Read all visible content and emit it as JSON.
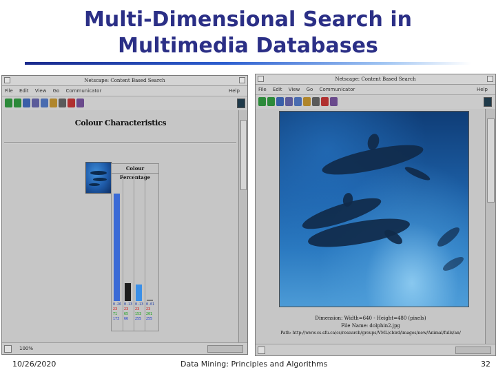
{
  "slide": {
    "title_line1": "Multi-Dimensional Search in",
    "title_line2": "Multimedia Databases",
    "footer_date": "10/26/2020",
    "footer_center": "Data Mining: Principles and Algorithms",
    "footer_page": "32",
    "colors": {
      "title": "#2b2f86",
      "rule_start": "#1a2a8c",
      "rule_end": "#9fc4f2"
    }
  },
  "left_window": {
    "title": "Netscape: Content Based Search",
    "menu": [
      "File",
      "Edit",
      "View",
      "Go",
      "Communicator"
    ],
    "help": "Help",
    "page_heading": "Colour Characteristics",
    "chart_title": "Colour Percentage",
    "bars": [
      {
        "value": 0.85,
        "color": "#3a6ad6"
      },
      {
        "value": 0.14,
        "color": "#1d1d1d"
      },
      {
        "value": 0.13,
        "color": "#3a8fe8"
      },
      {
        "value": 0.01,
        "color": "#7a7a7a"
      }
    ],
    "columns": [
      {
        "pct": "0.26",
        "r": "23",
        "g": "71",
        "b": "173"
      },
      {
        "pct": "0.13",
        "r": "23",
        "g": "65",
        "b": "66"
      },
      {
        "pct": "0.13",
        "r": "23",
        "g": "153",
        "b": "255"
      },
      {
        "pct": "0.01",
        "r": "23",
        "g": "201",
        "b": "255"
      }
    ],
    "status_text": "100%",
    "toolbar_icons": [
      "back-icon",
      "forward-icon",
      "reload-icon",
      "home-icon",
      "search-icon",
      "guide-icon",
      "print-icon",
      "security-icon",
      "stop-icon"
    ]
  },
  "right_window": {
    "title": "Netscape: Content Based Search",
    "menu": [
      "File",
      "Edit",
      "View",
      "Go",
      "Communicator"
    ],
    "help": "Help",
    "caption_dimension": "Dimension: Width=640 - Height=480 (pixels)",
    "caption_file": "File Name: dolphin2.jpg",
    "caption_path": "Path: http://www.cs.sfu.ca/cs/research/groups/VML/cbird/images/new/Animal/fulls/an/",
    "toolbar_icons": [
      "back-icon",
      "forward-icon",
      "reload-icon",
      "home-icon",
      "search-icon",
      "guide-icon",
      "print-icon",
      "security-icon",
      "stop-icon"
    ]
  }
}
